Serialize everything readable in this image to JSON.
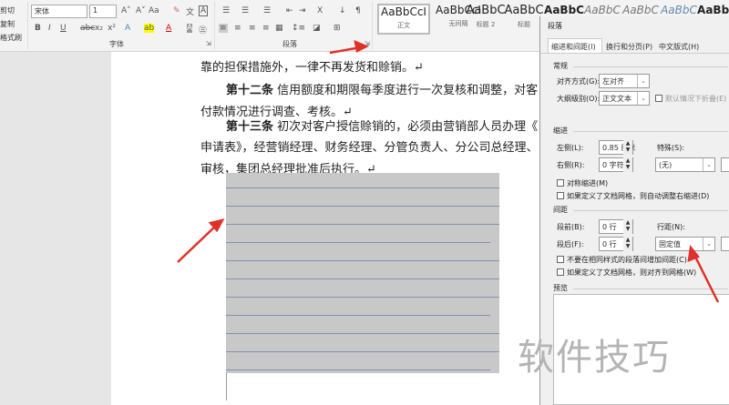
{
  "ribbon": {
    "clipboard": [
      "剪切",
      "复制",
      "格式刷"
    ],
    "font_name": "宋体",
    "font_size": "1",
    "font_group": "字体",
    "paragraph_group": "段落",
    "styles": [
      {
        "sample": "AaBbCcI",
        "name": "正文"
      },
      {
        "sample": "AaBbCcI",
        "name": "无间隔"
      },
      {
        "sample": "AaBbC",
        "name": "标题 2"
      },
      {
        "sample": "AaBbC",
        "name": "标题"
      },
      {
        "sample": "AaBbC",
        "name": ""
      },
      {
        "sample": "AaBbC",
        "name": ""
      },
      {
        "sample": "AaBbC",
        "name": ""
      },
      {
        "sample": "AaBbC",
        "name": ""
      },
      {
        "sample": "AaBbC",
        "name": ""
      }
    ]
  },
  "document": {
    "lines": [
      "靠的担保措施外，一律不再发货和赊销。↵",
      "信用额度和期限每季度进行一次复核和调整，对客",
      "付款情况进行调查、考核。↵",
      "初次对客户授信赊销的，必须由营销部人员办理《",
      "申请表》，经营销经理、财务经理、分管负责人、分公司总经理、",
      "审核，集团总经理批准后执行。↵"
    ],
    "art12": "第十二条",
    "art13": "第十三条"
  },
  "dialog": {
    "title": "段落",
    "tabs": [
      "缩进和间距(I)",
      "换行和分页(P)",
      "中文版式(H)"
    ],
    "general": "常规",
    "alignment_label": "对齐方式(G):",
    "alignment_value": "左对齐",
    "outline_label": "大纲级别(O):",
    "outline_value": "正文文本",
    "collapse_label": "默认情况下折叠(E)",
    "indent": "缩进",
    "left_label": "左侧(L):",
    "left_value": "0.85 厘米",
    "right_label": "右侧(R):",
    "right_value": "0 字符",
    "special_label": "特殊(S):",
    "special_value": "(无)",
    "mirror_label": "对称缩进(M)",
    "auto_right_label": "如果定义了文档网格，则自动调整右缩进(D)",
    "spacing": "间距",
    "before_label": "段前(B):",
    "before_value": "0 行",
    "after_label": "段后(F):",
    "after_value": "0 行",
    "line_spacing_label": "行距(N):",
    "line_spacing_value": "固定值",
    "no_space_label": "不要在相同样式的段落间增加间距(C)",
    "snap_grid_label": "如果定义了文档网格，则对齐到网格(W)",
    "preview": "预览"
  },
  "watermark": "软件技巧",
  "colors": {
    "arrow": "#e0302a",
    "highlight": "#c8c8c8"
  }
}
